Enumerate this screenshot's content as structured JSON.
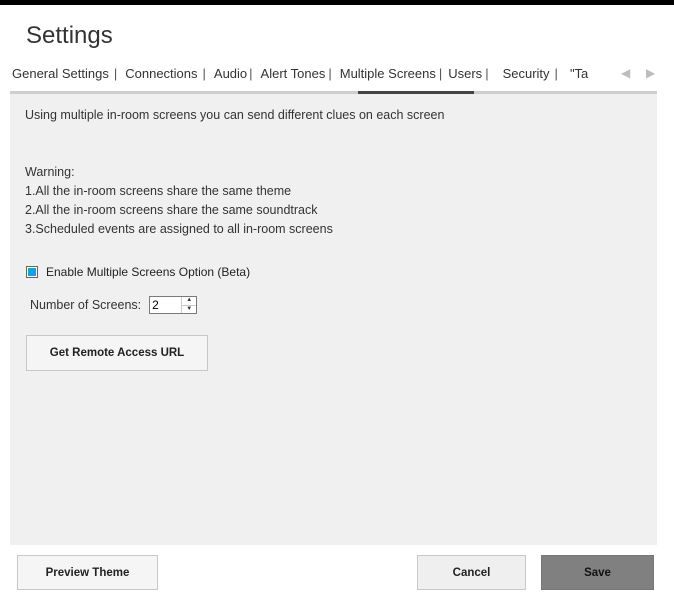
{
  "window": {
    "title": "Settings"
  },
  "tabs": [
    {
      "label": "General Settings",
      "active": false
    },
    {
      "label": "Connections",
      "active": false
    },
    {
      "label": "Audio",
      "active": false
    },
    {
      "label": "Alert Tones",
      "active": false
    },
    {
      "label": "Multiple Screens",
      "active": true
    },
    {
      "label": "Users",
      "active": false
    },
    {
      "label": "Security",
      "active": false
    },
    {
      "label": "\"Ta",
      "active": false
    }
  ],
  "tab_separator": "|",
  "tab_scroll": {
    "left_icon": "◀",
    "right_icon": "▶"
  },
  "content": {
    "intro": "Using multiple in-room screens you can send different clues on each screen",
    "warning_title": "Warning:",
    "warnings": [
      "1.All the in-room screens share the same theme",
      "2.All the in-room screens share the same soundtrack",
      "3.Scheduled events are assigned to all in-room screens"
    ],
    "enable_checkbox": {
      "label": "Enable Multiple Screens Option (Beta)",
      "checked": true
    },
    "num_screens": {
      "label": "Number of Screens:",
      "value": "2",
      "up": "▲",
      "down": "▼"
    },
    "remote_button": "Get Remote Access URL"
  },
  "footer": {
    "preview_label": "Preview Theme",
    "cancel_label": "Cancel",
    "save_label": "Save"
  },
  "colors": {
    "accent": "#1aa0d8",
    "save_bg": "#808080",
    "panel_bg": "#f0f0f0"
  }
}
